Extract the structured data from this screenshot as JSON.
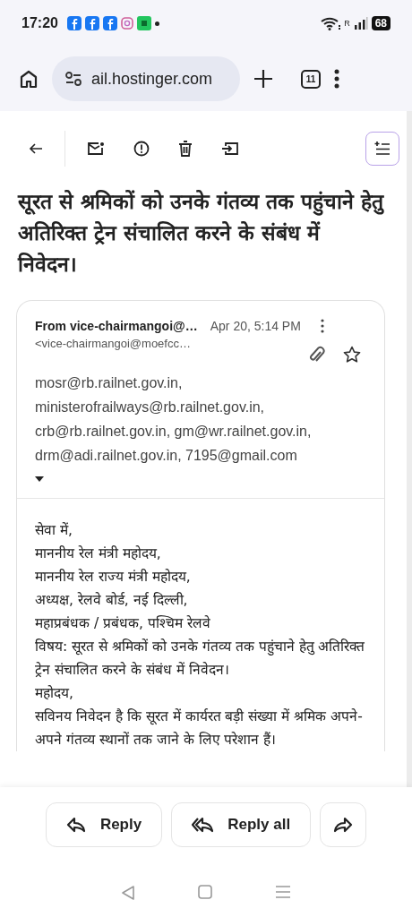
{
  "status_bar": {
    "time": "17:20",
    "network_label": "R",
    "battery": "68"
  },
  "browser": {
    "url": "ail.hostinger.com",
    "tab_count": "11"
  },
  "email": {
    "subject": "सूरत से श्रमिकों को उनके गंतव्य तक पहुंचाने हेतु अतिरिक्त ट्रेन संचालित करने के संबंध में निवेदन।",
    "from": "From vice-chairmangoi@…",
    "address": "<vice-chairmangoi@moefcc…",
    "date": "Apr 20, 5:14 PM",
    "starred": false,
    "recipients": [
      "mosr@rb.railnet.gov.in,",
      "ministerofrailways@rb.railnet.gov.in,",
      "crb@rb.railnet.gov.in, gm@wr.railnet.gov.in,",
      "drm@adi.railnet.gov.in, 7195@gmail.com"
    ],
    "body": [
      "सेवा में,",
      "माननीय रेल मंत्री महोदय,",
      "माननीय रेल राज्य मंत्री महोदय,",
      "अध्यक्ष, रेलवे बोर्ड, नई दिल्ली,",
      "महाप्रबंधक / प्रबंधक, पश्चिम रेलवे",
      "विषय: सूरत से श्रमिकों को उनके गंतव्य तक पहुंचाने हेतु अतिरिक्त ट्रेन संचालित करने के संबंध में निवेदन।",
      "महोदय,",
      "सविनय निवेदन है कि सूरत में कार्यरत बड़ी संख्या में श्रमिक अपने-अपने गंतव्य स्थानों तक जाने के लिए परेशान हैं।"
    ]
  },
  "actions": [
    {
      "kind": "reply",
      "label": "Reply"
    },
    {
      "kind": "reply_all",
      "label": "Reply all"
    },
    {
      "kind": "forward"
    }
  ]
}
